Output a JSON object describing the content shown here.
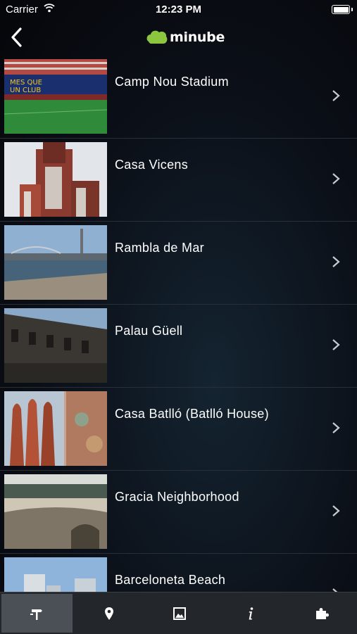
{
  "status_bar": {
    "carrier": "Carrier",
    "time": "12:23 PM",
    "battery_level": 1.0
  },
  "nav": {
    "back_icon": "chevron-left-icon",
    "logo_text": "minube",
    "logo_color": "#8cc63f"
  },
  "places": [
    {
      "name": "Camp Nou Stadium"
    },
    {
      "name": "Casa Vicens"
    },
    {
      "name": "Rambla de Mar"
    },
    {
      "name": "Palau Güell"
    },
    {
      "name": "Casa Batlló (Batlló House)"
    },
    {
      "name": "Gracia Neighborhood"
    },
    {
      "name": "Barceloneta Beach"
    }
  ],
  "tabs": [
    {
      "icon": "signpost-icon",
      "active": true
    },
    {
      "icon": "map-pin-icon",
      "active": false
    },
    {
      "icon": "photo-icon",
      "active": false
    },
    {
      "icon": "info-icon",
      "active": false
    },
    {
      "icon": "puzzle-icon",
      "active": false
    }
  ]
}
